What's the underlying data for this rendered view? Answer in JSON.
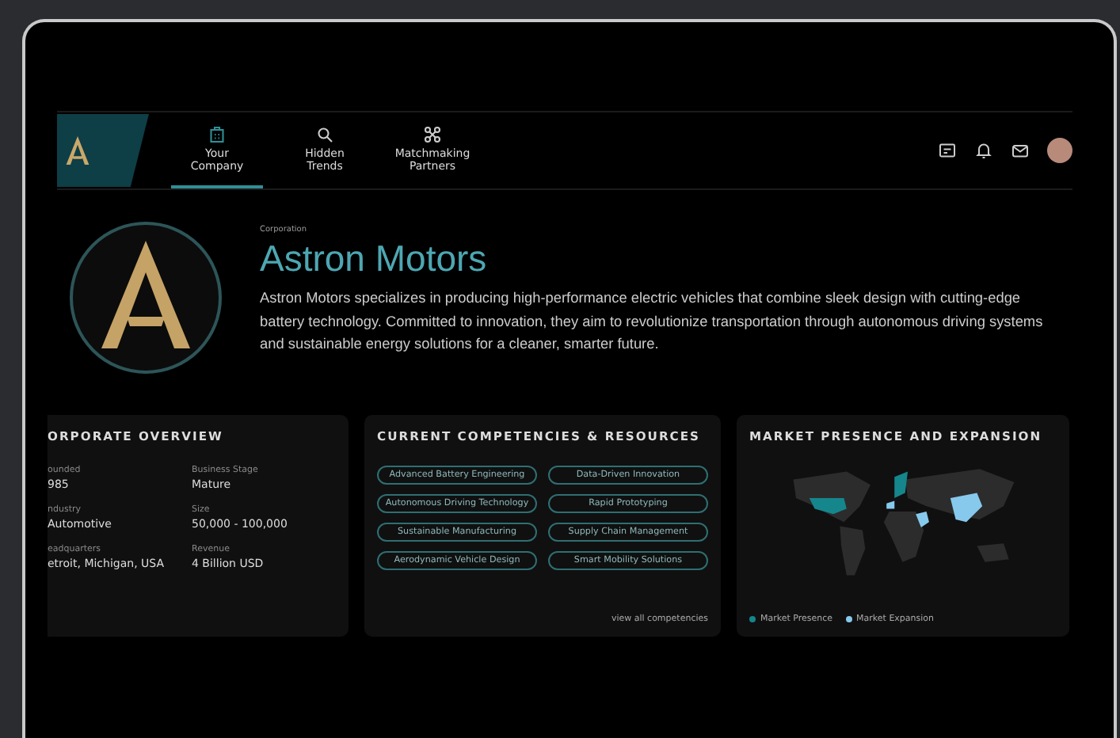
{
  "nav": {
    "tabs": [
      {
        "label": "Your Company",
        "kind": "building",
        "selected": true
      },
      {
        "label": "Hidden Trends",
        "kind": "search",
        "selected": false
      },
      {
        "label": "Matchmaking Partners",
        "kind": "network",
        "selected": false
      }
    ]
  },
  "company": {
    "type": "Corporation",
    "name": "Astron Motors",
    "description": "Astron Motors specializes in producing high-performance electric vehicles that combine sleek design with cutting-edge battery technology. Committed to innovation, they aim to revolutionize transportation through autonomous driving systems and sustainable energy solutions for a cleaner, smarter future."
  },
  "overview": {
    "title": "ORPORATE OVERVIEW",
    "fields": [
      {
        "label": "ounded",
        "value": "985"
      },
      {
        "label": "Business Stage",
        "value": "Mature"
      },
      {
        "label": "ndustry",
        "value": "Automotive"
      },
      {
        "label": "Size",
        "value": "50,000 - 100,000"
      },
      {
        "label": "eadquarters",
        "value": "etroit, Michigan, USA"
      },
      {
        "label": "Revenue",
        "value": "4 Billion USD"
      }
    ]
  },
  "competencies": {
    "title": "CURRENT COMPETENCIES & RESOURCES",
    "items": [
      "Advanced Battery Engineering",
      "Data-Driven Innovation",
      "Autonomous Driving Technology",
      "Rapid Prototyping",
      "Sustainable Manufacturing",
      "Supply Chain Management",
      "Aerodynamic Vehicle Design",
      "Smart Mobility Solutions"
    ],
    "link": "view all competencies"
  },
  "market": {
    "title": "MARKET PRESENCE AND EXPANSION",
    "legend": [
      {
        "label": "Market Presence",
        "color": "#15868c"
      },
      {
        "label": "Market Expansion",
        "color": "#86c9ec"
      }
    ]
  }
}
